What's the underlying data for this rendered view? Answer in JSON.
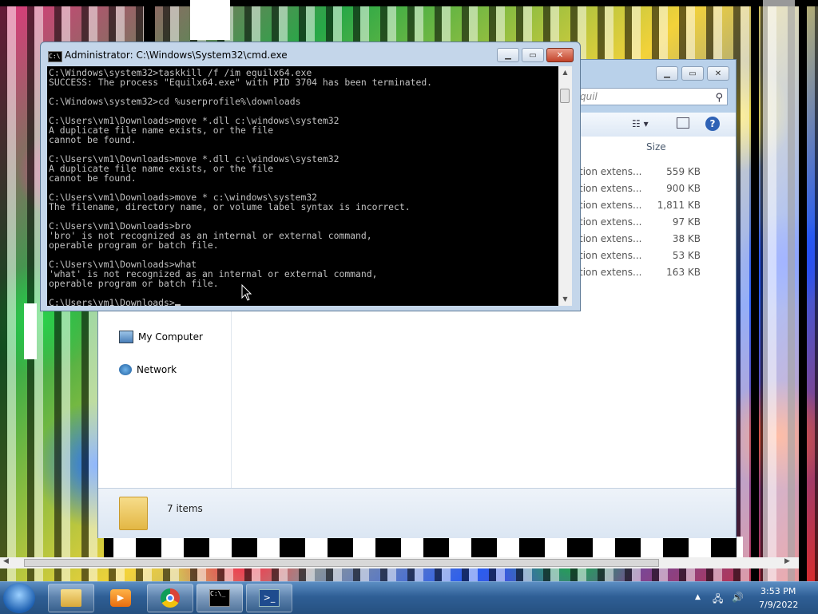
{
  "cmd": {
    "title": "Administrator: C:\\Windows\\System32\\cmd.exe",
    "lines": [
      "C:\\Windows\\system32>taskkill /f /im equilx64.exe",
      "SUCCESS: The process \"Equilx64.exe\" with PID 3704 has been terminated.",
      "",
      "C:\\Windows\\system32>cd %userprofile%\\downloads",
      "",
      "C:\\Users\\vm1\\Downloads>move *.dll c:\\windows\\system32",
      "A duplicate file name exists, or the file",
      "cannot be found.",
      "",
      "C:\\Users\\vm1\\Downloads>move *.dll c:\\windows\\system32",
      "A duplicate file name exists, or the file",
      "cannot be found.",
      "",
      "C:\\Users\\vm1\\Downloads>move * c:\\windows\\system32",
      "The filename, directory name, or volume label syntax is incorrect.",
      "",
      "C:\\Users\\vm1\\Downloads>bro",
      "'bro' is not recognized as an internal or external command,",
      "operable program or batch file.",
      "",
      "C:\\Users\\vm1\\Downloads>what",
      "'what' is not recognized as an internal or external command,",
      "operable program or batch file.",
      "",
      "C:\\Users\\vm1\\Downloads>"
    ]
  },
  "explorer": {
    "search_placeholder": "quil",
    "size_header": "Size",
    "rows": [
      {
        "type": "tion extens...",
        "size": "559 KB"
      },
      {
        "type": "tion extens...",
        "size": "900 KB"
      },
      {
        "type": "tion extens...",
        "size": "1,811 KB"
      },
      {
        "type": "tion extens...",
        "size": "97 KB"
      },
      {
        "type": "tion extens...",
        "size": "38 KB"
      },
      {
        "type": "tion extens...",
        "size": "53 KB"
      },
      {
        "type": "tion extens...",
        "size": "163 KB"
      }
    ],
    "nav": {
      "my_computer": "My Computer",
      "network": "Network"
    },
    "status_count": "7 items"
  },
  "tray": {
    "time": "3:53 PM",
    "date": "7/9/2022"
  },
  "icons": [
    "cmd-icon",
    "folder-icon",
    "media-player-icon",
    "chrome-icon",
    "powershell-icon",
    "start-orb-icon",
    "network-icon",
    "volume-icon",
    "search-icon"
  ]
}
